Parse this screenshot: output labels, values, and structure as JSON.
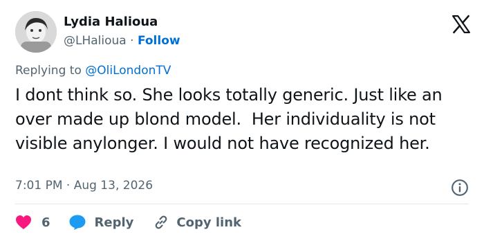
{
  "author": {
    "name": "Lydia Halioua",
    "handle": "@LHalioua",
    "separator": "·",
    "follow_label": "Follow",
    "avatar_icon": "profile-photo"
  },
  "platform_icon": "x-logo-icon",
  "reply_prefix": "Replying to",
  "reply_mention": "@OliLondonTV",
  "text": "I dont think so. She looks totally generic. Just like an over made up blond model.  Her individuality is not visible anylonger. I would not have recognized her.",
  "timestamp": "7:01 PM · Aug 13, 2026",
  "actions": {
    "likes_count": "6",
    "reply_label": "Reply",
    "copy_label": "Copy link"
  },
  "colors": {
    "link": "#006fd6",
    "like": "#f91880",
    "reply": "#1d9bf0",
    "muted": "#536471",
    "text": "#0f1419"
  }
}
